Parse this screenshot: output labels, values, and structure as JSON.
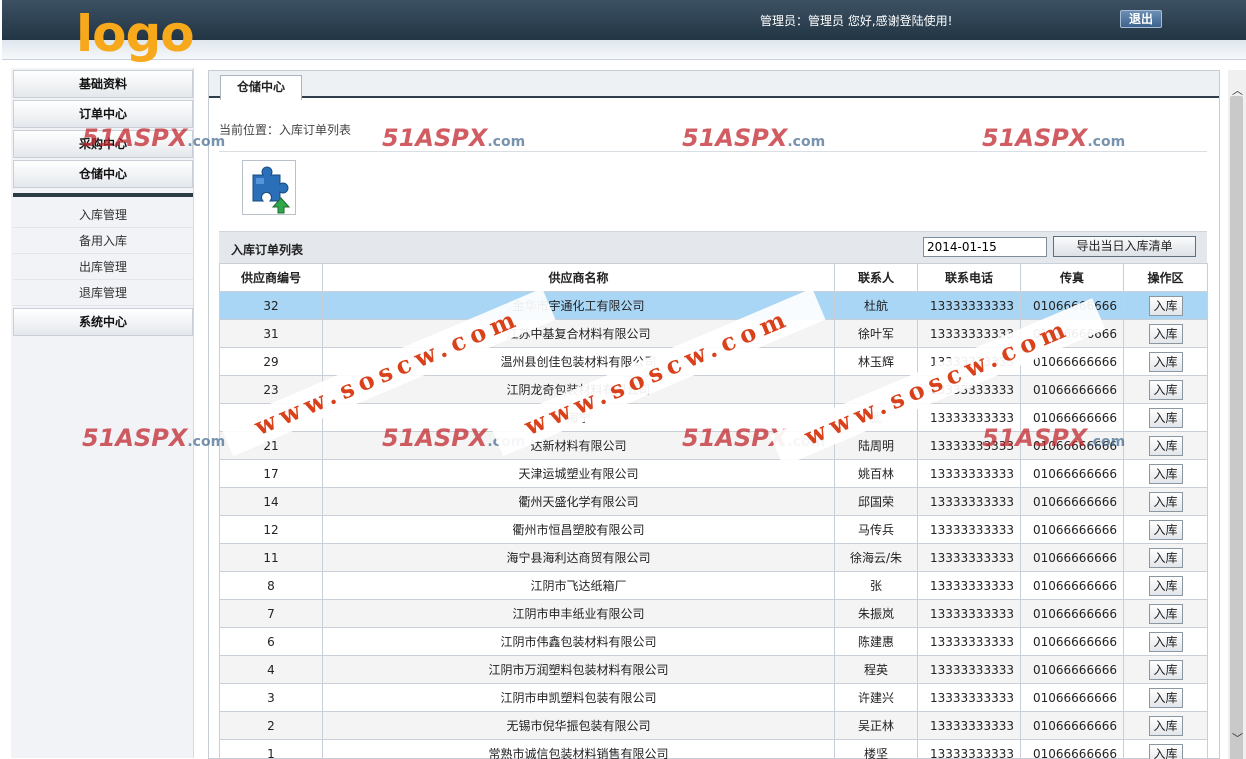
{
  "header": {
    "logo": "logo",
    "greeting": "管理员：管理员 您好,感谢登陆使用!",
    "logout_label": "退出"
  },
  "sidebar": {
    "groups": [
      "基础资料",
      "订单中心",
      "采购中心",
      "仓储中心",
      "系统中心"
    ],
    "sub_items": [
      "入库管理",
      "备用入库",
      "出库管理",
      "退库管理"
    ]
  },
  "main": {
    "tab_label": "仓储中心",
    "breadcrumb": "当前位置：入库订单列表",
    "icon": "puzzle-upload-icon",
    "list_title": "入库订单列表",
    "date_value": "2014-01-15",
    "export_label": "导出当日入库清单",
    "columns": [
      "供应商编号",
      "供应商名称",
      "联系人",
      "联系电话",
      "传真",
      "操作区"
    ],
    "rows": [
      {
        "id": "32",
        "name": "金华市宇通化工有限公司",
        "contact": "杜航",
        "phone": "13333333333",
        "fax": "01066666666",
        "action": "入库"
      },
      {
        "id": "31",
        "name": "江苏中基复合材料有限公司",
        "contact": "徐叶军",
        "phone": "13333333333",
        "fax": "01066666666",
        "action": "入库"
      },
      {
        "id": "29",
        "name": "温州县创佳包装材料有限公司",
        "contact": "林玉辉",
        "phone": "13333333333",
        "fax": "01066666666",
        "action": "入库"
      },
      {
        "id": "23",
        "name": "江阴龙奇包装材料有限公司",
        "contact": "",
        "phone": "13333333333",
        "fax": "01066666666",
        "action": "入库"
      },
      {
        "id": "",
        "name": "海宁",
        "contact": "武",
        "phone": "13333333333",
        "fax": "01066666666",
        "action": "入库"
      },
      {
        "id": "21",
        "name": "达新材料有限公司",
        "contact": "陆周明",
        "phone": "13333333333",
        "fax": "01066666666",
        "action": "入库"
      },
      {
        "id": "17",
        "name": "天津运城塑业有限公司",
        "contact": "姚百林",
        "phone": "13333333333",
        "fax": "01066666666",
        "action": "入库"
      },
      {
        "id": "14",
        "name": "衢州天盛化学有限公司",
        "contact": "邱国荣",
        "phone": "13333333333",
        "fax": "01066666666",
        "action": "入库"
      },
      {
        "id": "12",
        "name": "衢州市恒昌塑胶有限公司",
        "contact": "马传兵",
        "phone": "13333333333",
        "fax": "01066666666",
        "action": "入库"
      },
      {
        "id": "11",
        "name": "海宁县海利达商贸有限公司",
        "contact": "徐海云/朱",
        "phone": "13333333333",
        "fax": "01066666666",
        "action": "入库"
      },
      {
        "id": "8",
        "name": "江阴市飞达纸箱厂",
        "contact": "张",
        "phone": "13333333333",
        "fax": "01066666666",
        "action": "入库"
      },
      {
        "id": "7",
        "name": "江阴市申丰纸业有限公司",
        "contact": "朱振岚",
        "phone": "13333333333",
        "fax": "01066666666",
        "action": "入库"
      },
      {
        "id": "6",
        "name": "江阴市伟鑫包装材料有限公司",
        "contact": "陈建惠",
        "phone": "13333333333",
        "fax": "01066666666",
        "action": "入库"
      },
      {
        "id": "4",
        "name": "江阴市万润塑料包装材料有限公司",
        "contact": "程英",
        "phone": "13333333333",
        "fax": "01066666666",
        "action": "入库"
      },
      {
        "id": "3",
        "name": "江阴市申凯塑料包装有限公司",
        "contact": "许建兴",
        "phone": "13333333333",
        "fax": "01066666666",
        "action": "入库"
      },
      {
        "id": "2",
        "name": "无锡市倪华振包装有限公司",
        "contact": "吴正林",
        "phone": "13333333333",
        "fax": "01066666666",
        "action": "入库"
      },
      {
        "id": "1",
        "name": "常熟市诚信包装材料销售有限公司",
        "contact": "楼坚",
        "phone": "13333333333",
        "fax": "01066666666",
        "action": "入库"
      }
    ]
  },
  "watermarks": {
    "brand": "51ASPX",
    "brand_suffix": ".com",
    "site": "www.soscw.com"
  },
  "colors": {
    "header_dark": "#2a3d4e",
    "logo": "#f7a81b",
    "selected_row": "#a9d6f5"
  }
}
